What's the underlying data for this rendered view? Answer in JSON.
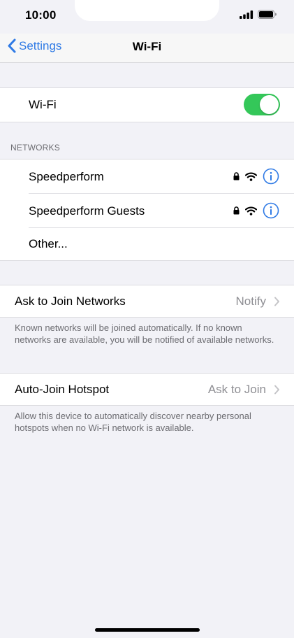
{
  "status_bar": {
    "time": "10:00"
  },
  "nav": {
    "back_label": "Settings",
    "title": "Wi-Fi"
  },
  "wifi": {
    "label": "Wi-Fi",
    "enabled": true
  },
  "networks": {
    "header": "NETWORKS",
    "items": [
      {
        "name": "Speedperform",
        "secured": true
      },
      {
        "name": "Speedperform Guests",
        "secured": true
      }
    ],
    "other_label": "Other..."
  },
  "ask_to_join": {
    "label": "Ask to Join Networks",
    "value": "Notify",
    "footnote": "Known networks will be joined automatically. If no known networks are available, you will be notified of available networks."
  },
  "auto_join_hotspot": {
    "label": "Auto-Join Hotspot",
    "value": "Ask to Join",
    "footnote": "Allow this device to automatically discover nearby personal hotspots when no Wi-Fi network is available."
  },
  "colors": {
    "accent": "#2f7ae5",
    "toggle_on": "#34c759",
    "background": "#f2f2f7"
  },
  "icons": [
    "signal-bars-icon",
    "wifi-icon",
    "battery-icon",
    "lock-icon",
    "info-icon",
    "chevron-right-icon",
    "chevron-left-icon"
  ]
}
